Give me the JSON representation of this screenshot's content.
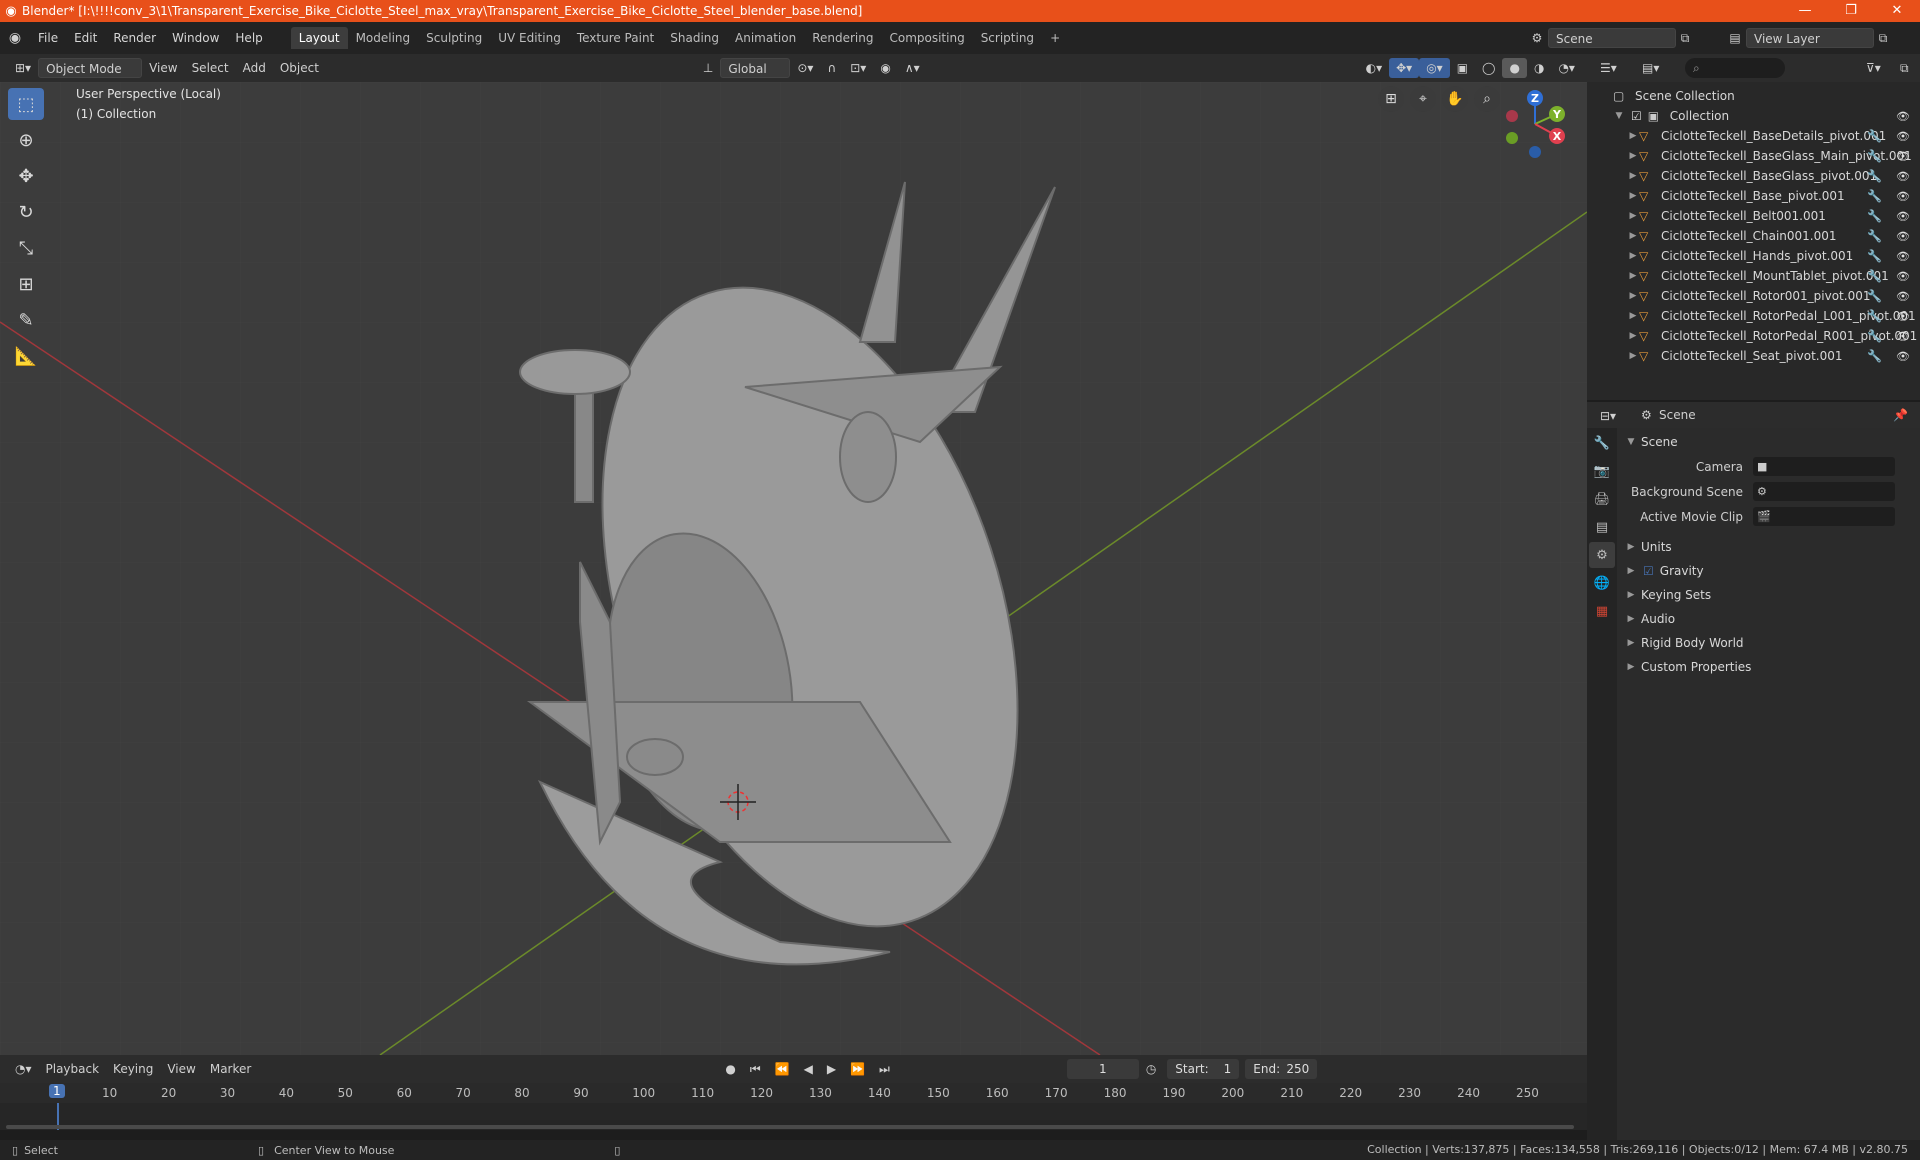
{
  "window": {
    "title": "Blender* [I:\\!!!!conv_3\\1\\Transparent_Exercise_Bike_Ciclotte_Steel_max_vray\\Transparent_Exercise_Bike_Ciclotte_Steel_blender_base.blend]",
    "minimize": "—",
    "maximize": "❐",
    "close": "✕"
  },
  "menus": [
    "File",
    "Edit",
    "Render",
    "Window",
    "Help"
  ],
  "workspaces": [
    "Layout",
    "Modeling",
    "Sculpting",
    "UV Editing",
    "Texture Paint",
    "Shading",
    "Animation",
    "Rendering",
    "Compositing",
    "Scripting"
  ],
  "workspace_add": "+",
  "scene_name": "Scene",
  "view_layer": "View Layer",
  "viewport_header": {
    "mode": "Object Mode",
    "view": "View",
    "select": "Select",
    "add": "Add",
    "object": "Object",
    "transform": "Global"
  },
  "overlay_text": {
    "line1": "User Perspective (Local)",
    "line2": "(1) Collection"
  },
  "gizmo": {
    "z": "Z",
    "y": "Y",
    "x": "X"
  },
  "outliner": {
    "root": "Scene Collection",
    "collection": "Collection",
    "objects": [
      "CiclotteTeckell_BaseDetails_pivot.001",
      "CiclotteTeckell_BaseGlass_Main_pivot.001",
      "CiclotteTeckell_BaseGlass_pivot.001",
      "CiclotteTeckell_Base_pivot.001",
      "CiclotteTeckell_Belt001.001",
      "CiclotteTeckell_Chain001.001",
      "CiclotteTeckell_Hands_pivot.001",
      "CiclotteTeckell_MountTablet_pivot.001",
      "CiclotteTeckell_Rotor001_pivot.001",
      "CiclotteTeckell_RotorPedal_L001_pivot.001",
      "CiclotteTeckell_RotorPedal_R001_pivot.001",
      "CiclotteTeckell_Seat_pivot.001"
    ]
  },
  "properties": {
    "header": "Scene",
    "section": "Scene",
    "camera_label": "Camera",
    "background_scene_label": "Background Scene",
    "active_movie_clip_label": "Active Movie Clip",
    "panels": [
      "Units",
      "Gravity",
      "Keying Sets",
      "Audio",
      "Rigid Body World",
      "Custom Properties"
    ]
  },
  "timeline": {
    "playback": "Playback",
    "keying": "Keying",
    "view": "View",
    "marker": "Marker",
    "current_frame": "1",
    "start_label": "Start:",
    "start": "1",
    "end_label": "End:",
    "end": "250",
    "ticks": [
      "1",
      "10",
      "20",
      "30",
      "40",
      "50",
      "60",
      "70",
      "80",
      "90",
      "100",
      "110",
      "120",
      "130",
      "140",
      "150",
      "160",
      "170",
      "180",
      "190",
      "200",
      "210",
      "220",
      "230",
      "240",
      "250"
    ]
  },
  "status": {
    "select": "Select",
    "center": "Center View to Mouse",
    "stats": "Collection | Verts:137,875 | Faces:134,558 | Tris:269,116 | Objects:0/12 | Mem: 67.4 MB | v2.80.75"
  }
}
